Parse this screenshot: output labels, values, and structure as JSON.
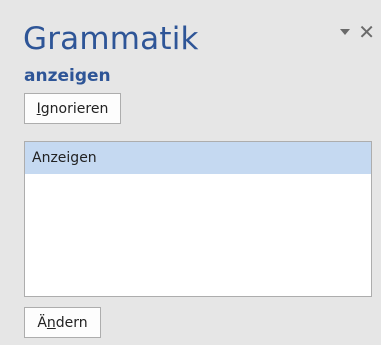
{
  "pane": {
    "title": "Grammatik",
    "options_icon": "dropdown-arrow-icon",
    "close_icon": "close-icon",
    "close_glyph": "✕"
  },
  "error_word": "anzeigen",
  "buttons": {
    "ignore": {
      "access_key": "I",
      "rest": "gnorieren"
    },
    "change": {
      "before": "Ä",
      "access_key": "n",
      "rest": "dern"
    }
  },
  "suggestions": {
    "items": [
      "Anzeigen"
    ],
    "selected": "Anzeigen"
  },
  "colors": {
    "background": "#e6e6e6",
    "title": "#2e5597",
    "selection": "#c5d9f1"
  }
}
